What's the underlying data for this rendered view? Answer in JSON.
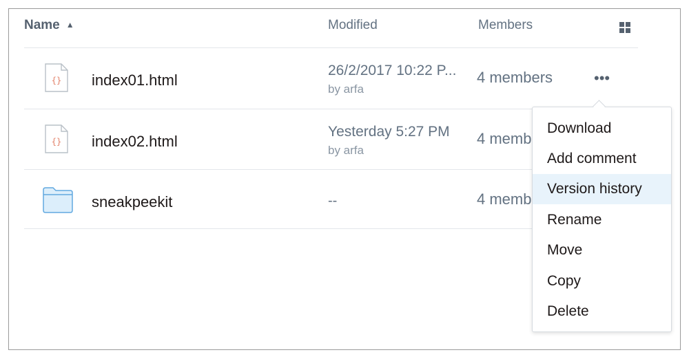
{
  "header": {
    "name_label": "Name",
    "sort_icon": "sort-ascending-icon",
    "modified_label": "Modified",
    "members_label": "Members",
    "view_toggle_icon": "grid-view-icon"
  },
  "files": [
    {
      "name": "index01.html",
      "icon": "html-file-icon",
      "modified": "26/2/2017 10:22 P...",
      "modified_by": "by arfa",
      "members": "4 members"
    },
    {
      "name": "index02.html",
      "icon": "html-file-icon",
      "modified": "Yesterday 5:27 PM",
      "modified_by": "by arfa",
      "members": "4 memb"
    },
    {
      "name": "sneakpeekit",
      "icon": "folder-icon",
      "modified": "--",
      "modified_by": "",
      "members": "4 memb"
    }
  ],
  "row_actions": {
    "more_icon": "more-options-icon",
    "more_glyph": "•••"
  },
  "context_menu": {
    "items": [
      "Download",
      "Add comment",
      "Version history",
      "Rename",
      "Move",
      "Copy",
      "Delete"
    ],
    "highlighted": "Version history"
  },
  "colors": {
    "accent_blue": "#61a8e0",
    "text_primary": "#1e1919",
    "text_secondary": "#637282",
    "highlight_bg": "#e8f3fb",
    "file_glyph": "#e3826a"
  }
}
